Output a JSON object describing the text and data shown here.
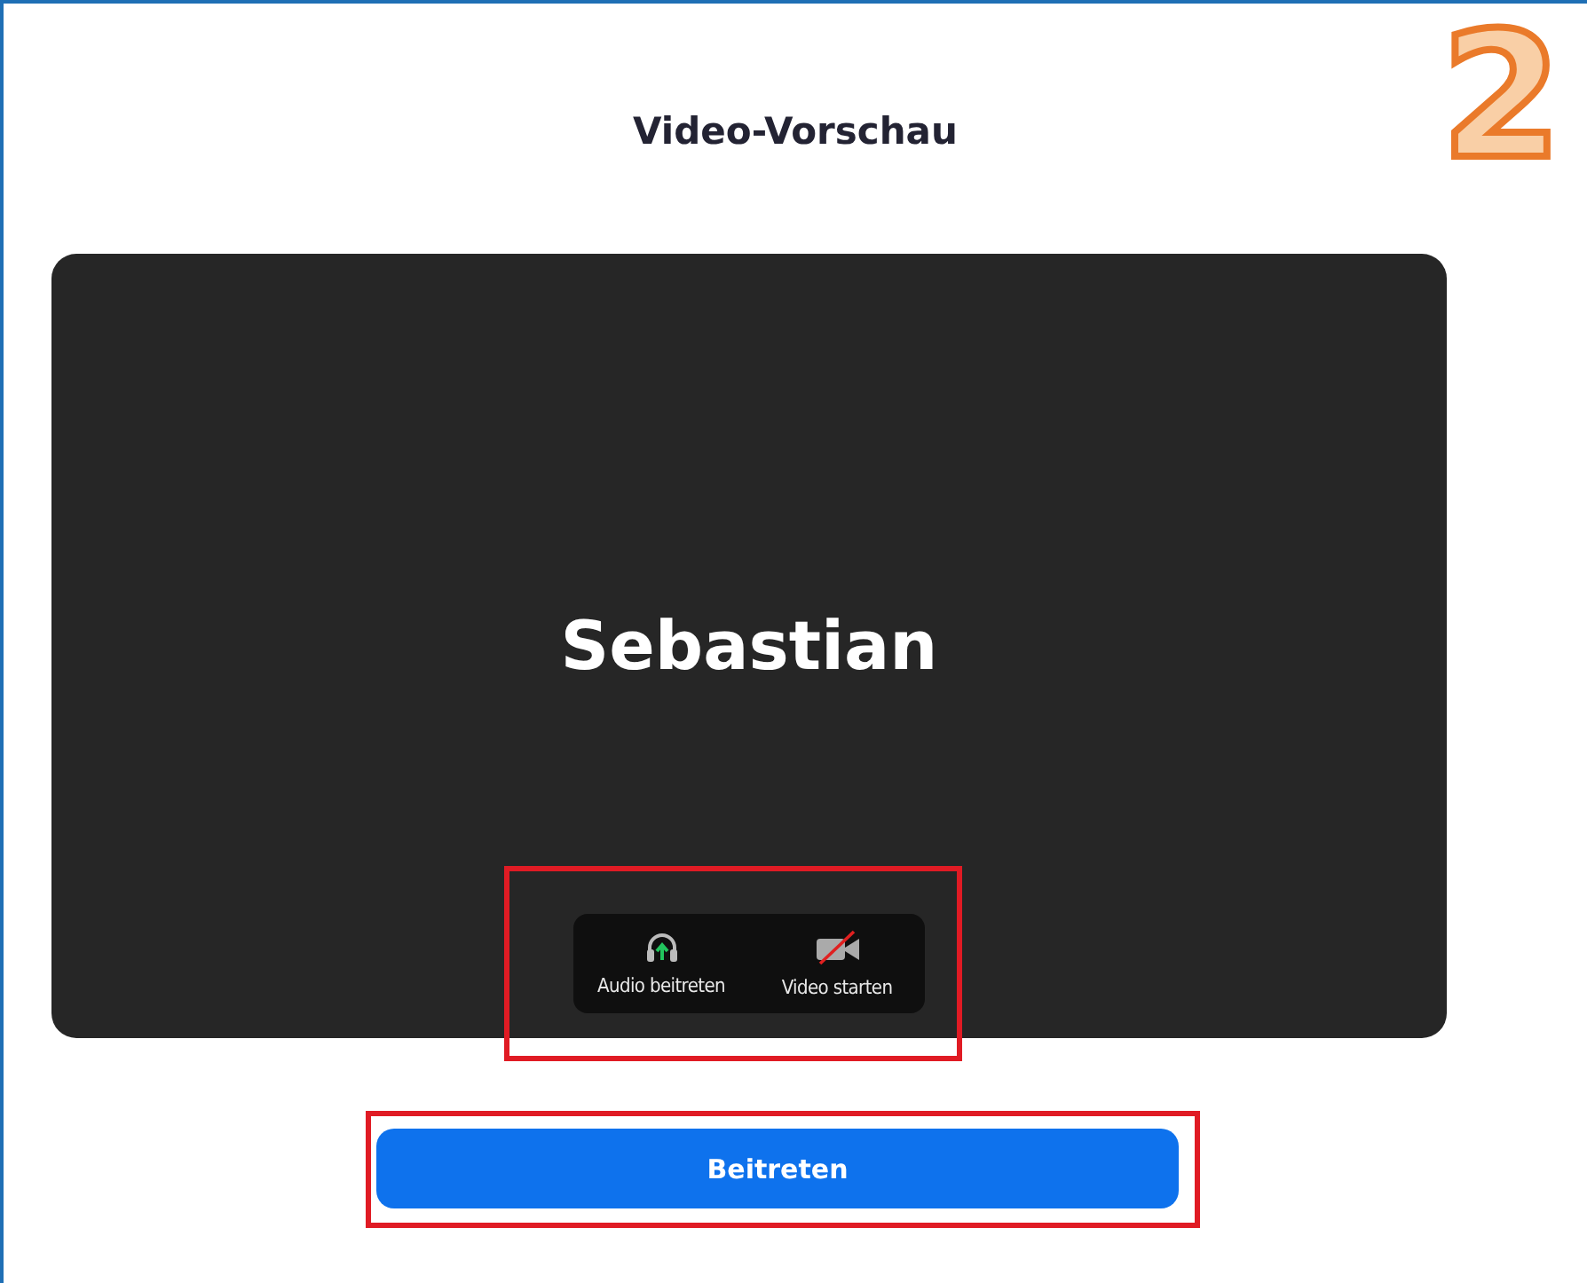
{
  "step_badge": "2",
  "title": "Video-Vorschau",
  "preview": {
    "participant_name": "Sebastian"
  },
  "media_controls": {
    "highlighted": true,
    "buttons": [
      {
        "kind": "audio",
        "label": "Audio beitreten"
      },
      {
        "kind": "video",
        "label": "Video starten",
        "on": false
      }
    ]
  },
  "join_button": {
    "label": "Beitreten",
    "highlighted": true
  }
}
